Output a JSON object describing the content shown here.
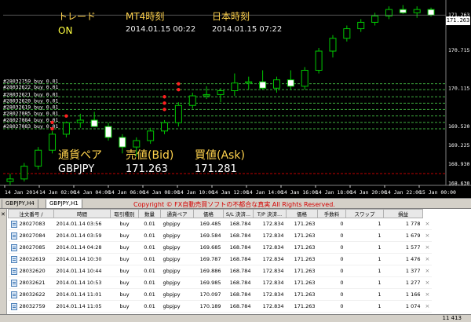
{
  "header": {
    "col1_title": "トレード",
    "col2_title": "MT4時刻",
    "col3_title": "日本時刻",
    "trade_status": "ON",
    "mt4_time": "2014.01.15 00:22",
    "jp_time": "2014.01.15 07:22"
  },
  "price_panel": {
    "pair_label": "通貨ペア",
    "bid_label": "売値(Bid)",
    "ask_label": "買値(Ask)",
    "pair": "GBPJPY",
    "bid": "171.263",
    "ask": "171.281"
  },
  "chart_data": {
    "type": "candlestick",
    "symbol": "GBPJPY",
    "timeframe": "H1",
    "current_price": "171.263",
    "y_ticks": [
      "171.263",
      "170.715",
      "170.115",
      "169.520",
      "169.225",
      "168.930",
      "168.630"
    ],
    "x_ticks": [
      "14 Jan 2014",
      "14 Jan 02:00",
      "14 Jan 04:00",
      "14 Jan 06:00",
      "14 Jan 08:00",
      "14 Jan 10:00",
      "14 Jan 12:00",
      "14 Jan 14:00",
      "14 Jan 16:00",
      "14 Jan 18:00",
      "14 Jan 20:00",
      "14 Jan 22:00",
      "15 Jan 00:00"
    ],
    "candles": [
      {
        "o": 168.66,
        "h": 168.78,
        "l": 168.6,
        "c": 168.7
      },
      {
        "o": 168.7,
        "h": 168.95,
        "l": 168.66,
        "c": 168.9
      },
      {
        "o": 168.9,
        "h": 169.2,
        "l": 168.85,
        "c": 169.15
      },
      {
        "o": 169.15,
        "h": 169.45,
        "l": 169.1,
        "c": 169.4
      },
      {
        "o": 169.4,
        "h": 169.6,
        "l": 169.35,
        "c": 169.58
      },
      {
        "o": 169.58,
        "h": 169.72,
        "l": 169.5,
        "c": 169.62
      },
      {
        "o": 169.62,
        "h": 169.75,
        "l": 169.55,
        "c": 169.52
      },
      {
        "o": 169.52,
        "h": 169.58,
        "l": 169.3,
        "c": 169.35
      },
      {
        "o": 169.35,
        "h": 169.4,
        "l": 169.1,
        "c": 169.2
      },
      {
        "o": 169.2,
        "h": 169.35,
        "l": 169.05,
        "c": 169.3
      },
      {
        "o": 169.3,
        "h": 169.5,
        "l": 169.25,
        "c": 169.45
      },
      {
        "o": 169.45,
        "h": 169.62,
        "l": 169.4,
        "c": 169.58
      },
      {
        "o": 169.58,
        "h": 169.9,
        "l": 169.52,
        "c": 169.85
      },
      {
        "o": 169.85,
        "h": 170.05,
        "l": 169.8,
        "c": 170.0
      },
      {
        "o": 170.0,
        "h": 170.15,
        "l": 169.95,
        "c": 170.02
      },
      {
        "o": 170.02,
        "h": 170.12,
        "l": 169.9,
        "c": 170.08
      },
      {
        "o": 170.08,
        "h": 170.35,
        "l": 170.0,
        "c": 170.2
      },
      {
        "o": 170.2,
        "h": 170.3,
        "l": 170.1,
        "c": 170.22
      },
      {
        "o": 170.22,
        "h": 170.4,
        "l": 170.1,
        "c": 170.12
      },
      {
        "o": 170.12,
        "h": 170.3,
        "l": 170.05,
        "c": 170.25
      },
      {
        "o": 170.25,
        "h": 170.4,
        "l": 170.1,
        "c": 170.15
      },
      {
        "o": 170.15,
        "h": 170.45,
        "l": 170.1,
        "c": 170.4
      },
      {
        "o": 170.4,
        "h": 170.75,
        "l": 170.35,
        "c": 170.7
      },
      {
        "o": 170.7,
        "h": 170.95,
        "l": 170.6,
        "c": 170.9
      },
      {
        "o": 170.9,
        "h": 171.1,
        "l": 170.85,
        "c": 171.05
      },
      {
        "o": 171.05,
        "h": 171.2,
        "l": 171.0,
        "c": 171.15
      },
      {
        "o": 171.15,
        "h": 171.3,
        "l": 171.1,
        "c": 171.25
      },
      {
        "o": 171.25,
        "h": 171.4,
        "l": 171.2,
        "c": 171.35
      },
      {
        "o": 171.35,
        "h": 171.42,
        "l": 171.28,
        "c": 171.3
      },
      {
        "o": 171.3,
        "h": 171.4,
        "l": 171.22,
        "c": 171.35
      },
      {
        "o": 171.35,
        "h": 171.38,
        "l": 171.24,
        "c": 171.263
      }
    ],
    "order_lines": [
      {
        "label": "#28032759 buy 0.01",
        "price": 170.189
      },
      {
        "label": "#28032622 buy 0.01",
        "price": 170.097
      },
      {
        "label": "#28032621 buy 0.01",
        "price": 169.985
      },
      {
        "label": "#28032620 buy 0.01",
        "price": 169.886
      },
      {
        "label": "#28032619 buy 0.01",
        "price": 169.787
      },
      {
        "label": "#28027085 buy 0.01",
        "price": 169.685
      },
      {
        "label": "#28027084 buy 0.01",
        "price": 169.584
      },
      {
        "label": "#28027083 buy 0.01",
        "price": 169.485
      }
    ]
  },
  "tabs": {
    "tab1": "GBPJPY,H4",
    "tab2": "GBPJPY,H1",
    "copyright": "Copyright © FX自動売買ソフトの不都合な真実 All Rights Reserved."
  },
  "table": {
    "columns": [
      "注文番号 /",
      "時間",
      "取引種別",
      "数量",
      "通貨ペア",
      "価格",
      "S/L 決済...",
      "T/P 決済...",
      "価格",
      "手数料",
      "スワップ",
      "損益"
    ],
    "rows": [
      [
        "28027083",
        "2014.01.14 03:56",
        "buy",
        "0.01",
        "gbpjpy",
        "169.485",
        "168.784",
        "172.834",
        "171.263",
        "0",
        "1",
        "1 778"
      ],
      [
        "28027084",
        "2014.01.14 03:59",
        "buy",
        "0.01",
        "gbpjpy",
        "169.584",
        "168.784",
        "172.834",
        "171.263",
        "0",
        "1",
        "1 679"
      ],
      [
        "28027085",
        "2014.01.14 04:28",
        "buy",
        "0.01",
        "gbpjpy",
        "169.685",
        "168.784",
        "172.834",
        "171.263",
        "0",
        "1",
        "1 577"
      ],
      [
        "28032619",
        "2014.01.14 10:30",
        "buy",
        "0.01",
        "gbpjpy",
        "169.787",
        "168.784",
        "172.834",
        "171.263",
        "0",
        "1",
        "1 476"
      ],
      [
        "28032620",
        "2014.01.14 10:44",
        "buy",
        "0.01",
        "gbpjpy",
        "169.886",
        "168.784",
        "172.834",
        "171.263",
        "0",
        "1",
        "1 377"
      ],
      [
        "28032621",
        "2014.01.14 10:53",
        "buy",
        "0.01",
        "gbpjpy",
        "169.985",
        "168.784",
        "172.834",
        "171.263",
        "0",
        "1",
        "1 277"
      ],
      [
        "28032622",
        "2014.01.14 11:01",
        "buy",
        "0.01",
        "gbpjpy",
        "170.097",
        "168.784",
        "172.834",
        "171.263",
        "0",
        "1",
        "1 166"
      ],
      [
        "28032759",
        "2014.01.14 11:05",
        "buy",
        "0.01",
        "gbpjpy",
        "170.189",
        "168.784",
        "172.834",
        "171.263",
        "0",
        "1",
        "1 074"
      ]
    ]
  },
  "status": {
    "total": "11 413"
  }
}
